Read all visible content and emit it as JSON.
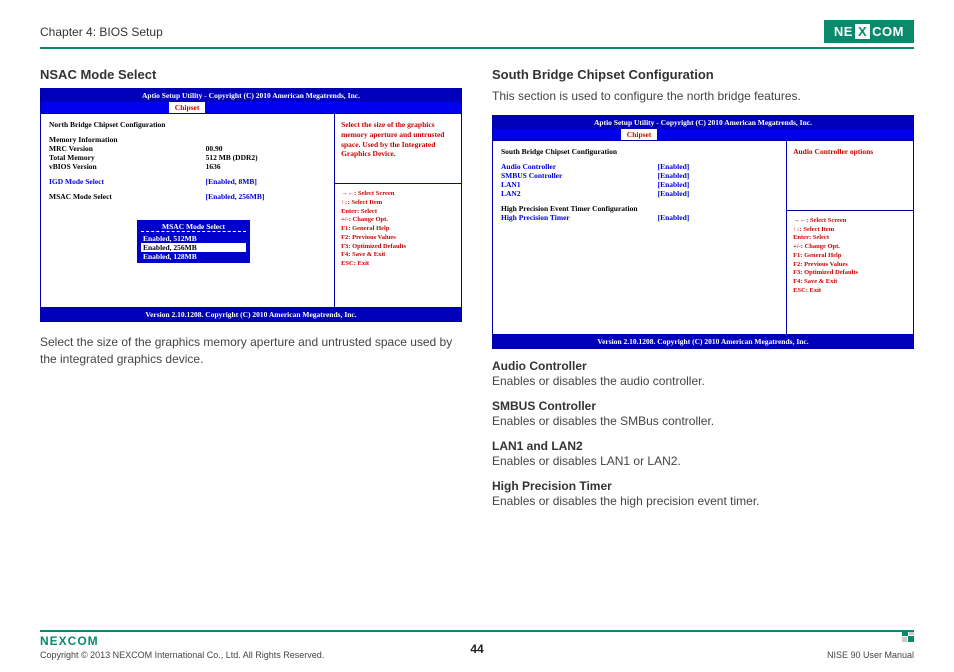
{
  "header": {
    "chapter": "Chapter 4: BIOS Setup",
    "brandPre": "NE",
    "brandX": "X",
    "brandPost": "COM"
  },
  "left": {
    "title": "NSAC Mode Select",
    "bios": {
      "topbar": "Aptio Setup Utility - Copyright (C) 2010 American Megatrends, Inc.",
      "tab": "Chipset",
      "heading": "North Bridge Chipset Configuration",
      "rows": {
        "memInfo": "Memory Information",
        "mrcLabel": "MRC Version",
        "mrcVal": "00.90",
        "totalLabel": "Total Memory",
        "totalVal": "  512 MB (DDR2)",
        "vbiosLabel": "vBIOS Version",
        "vbiosVal": "1636",
        "igdLabel": "IGD Mode Select",
        "igdVal": "[Enabled, 8MB]",
        "msacLabel": "MSAC Mode Select",
        "msacVal": "[Enabled, 256MB]"
      },
      "popup": {
        "title": "MSAC Mode Select",
        "opt1": "Enabled, 512MB",
        "opt2": "Enabled, 256MB",
        "opt3": "Enabled, 128MB"
      },
      "help": "Select the size of the graphics memory aperture and untrusted space. Used by the Integrated Graphics Device.",
      "keys": {
        "k1": "→←: Select Screen",
        "k2": "↑↓: Select Item",
        "k3": "Enter: Select",
        "k4": "+/-: Change Opt.",
        "k5": "F1: General Help",
        "k6": "F2: Previous Values",
        "k7": "F3: Optimized Defaults",
        "k8": "F4: Save & Exit",
        "k9": "ESC: Exit"
      },
      "footer": "Version 2.10.1208. Copyright (C) 2010 American Megatrends, Inc."
    },
    "caption": "Select the size of the graphics memory aperture and untrusted space used by the integrated graphics device."
  },
  "right": {
    "title": "South Bridge Chipset Configuration",
    "intro": "This section is used to configure the north bridge features.",
    "bios": {
      "topbar": "Aptio Setup Utility - Copyright (C) 2010 American Megatrends, Inc.",
      "tab": "Chipset",
      "heading": "South Bridge Chipset Configuration",
      "rows": {
        "audioLabel": "Audio Controller",
        "audioVal": "[Enabled]",
        "smbusLabel": "SMBUS Controller",
        "smbusVal": "[Enabled]",
        "lan1Label": "LAN1",
        "lan1Val": "[Enabled]",
        "lan2Label": "LAN2",
        "lan2Val": "[Enabled]",
        "hpetHeading": "High Precision Event Timer Configuration",
        "hptLabel": "High Precision Timer",
        "hptVal": "[Enabled]"
      },
      "help": "Audio Controller options",
      "footer": "Version 2.10.1208. Copyright (C) 2010 American Megatrends, Inc."
    },
    "descs": {
      "audioT": "Audio Controller",
      "audioD": "Enables or disables the audio controller.",
      "smbusT": "SMBUS Controller",
      "smbusD": "Enables or disables the SMBus controller.",
      "lanT": "LAN1 and LAN2",
      "lanD": "Enables or disables LAN1 or LAN2.",
      "hptT": "High Precision Timer",
      "hptD": "Enables or disables the high precision event timer."
    }
  },
  "footer": {
    "brand": "NEXCOM",
    "copyright": "Copyright © 2013 NEXCOM International Co., Ltd. All Rights Reserved.",
    "page": "44",
    "manual": "NISE 90 User Manual"
  }
}
